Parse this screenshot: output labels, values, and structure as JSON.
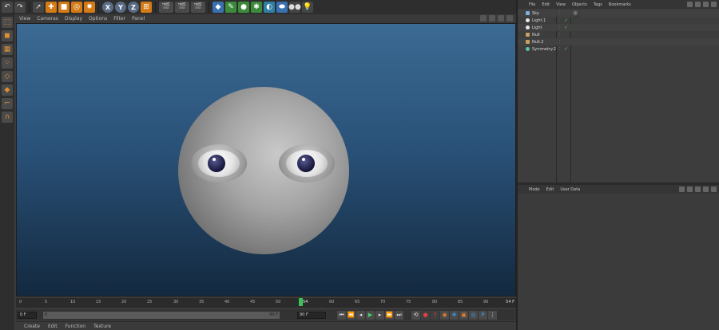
{
  "toolbar": {
    "undo_icon": "undo-icon",
    "axis_x": "X",
    "axis_y": "Y",
    "axis_z": "Z"
  },
  "viewport": {
    "menu": [
      "View",
      "Cameras",
      "Display",
      "Options",
      "Filter",
      "Panel"
    ]
  },
  "timeline": {
    "ticks": [
      "0",
      "5",
      "10",
      "15",
      "20",
      "25",
      "30",
      "35",
      "40",
      "45",
      "50",
      "54",
      "60",
      "65",
      "70",
      "75",
      "80",
      "85",
      "90"
    ],
    "current_frame": "54",
    "end_label": "54 F"
  },
  "transport": {
    "start_field": "0 F",
    "slider_start": "0",
    "slider_end": "90 F",
    "end_field": "90 F"
  },
  "bottom_menu": [
    "Create",
    "Edit",
    "Function",
    "Texture"
  ],
  "object_manager": {
    "menu": [
      "File",
      "Edit",
      "View",
      "Objects",
      "Tags",
      "Bookmarks"
    ],
    "objects": [
      {
        "name": "Sky",
        "icon_color": "#7fb0e0"
      },
      {
        "name": "Light.1",
        "icon_color": "#e8e8e8"
      },
      {
        "name": "Light",
        "icon_color": "#e8e8e8"
      },
      {
        "name": "Null",
        "icon_color": "#c8a060"
      },
      {
        "name": "Null.2",
        "icon_color": "#c8a060"
      },
      {
        "name": "Symmetry.2",
        "icon_color": "#60c0a0"
      }
    ]
  },
  "attribute_manager": {
    "menu": [
      "Mode",
      "Edit",
      "User Data"
    ]
  },
  "colors": {
    "viewport_top": "#3b6a92",
    "viewport_bottom": "#13293f",
    "accent_orange": "#d47a16",
    "playhead_green": "#39c45a"
  }
}
